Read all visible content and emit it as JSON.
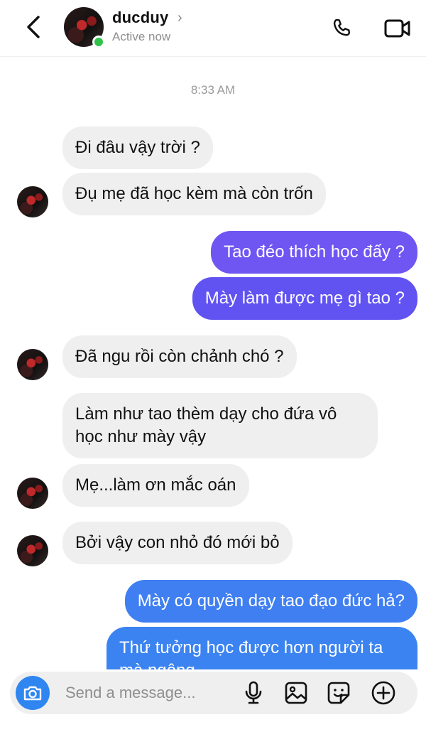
{
  "header": {
    "contact_name": "ducduy",
    "name_chevron": "›",
    "status": "Active now"
  },
  "conversation": {
    "timestamp": "8:33 AM",
    "messages": [
      {
        "from": "them",
        "text": "Đi đâu vậy trời ?"
      },
      {
        "from": "them",
        "text": "Đụ mẹ đã học kèm mà còn trốn"
      },
      {
        "from": "me",
        "text": "Tao đéo thích học đấy ?"
      },
      {
        "from": "me",
        "text": "Mày làm được mẹ gì tao ?"
      },
      {
        "from": "them",
        "text": "Đã ngu rồi còn chảnh chó ?"
      },
      {
        "from": "them",
        "text_lines": [
          "Làm như tao thèm dạy cho đứa vô",
          "học như mày vậy"
        ]
      },
      {
        "from": "them",
        "text": "Mẹ...làm ơn mắc oán"
      },
      {
        "from": "them",
        "text": "Bởi vậy con nhỏ đó mới bỏ"
      },
      {
        "from": "me",
        "text": "Mày có quyền dạy tao đạo đức hả?"
      },
      {
        "from": "me",
        "text_lines": [
          "Thứ tưởng học được hơn người ta",
          "mà ngông"
        ]
      }
    ]
  },
  "composer": {
    "placeholder": "Send a message..."
  },
  "colors": {
    "outgoing_top": "#7a4cf2",
    "outgoing_bottom": "#3b83f0",
    "incoming": "#efefef",
    "online": "#31c24a",
    "camera_button": "#2f86f0"
  },
  "icons": [
    "back-arrow-icon",
    "phone-icon",
    "video-camera-icon",
    "camera-icon",
    "microphone-icon",
    "image-icon",
    "sticker-icon",
    "plus-circle-icon"
  ]
}
